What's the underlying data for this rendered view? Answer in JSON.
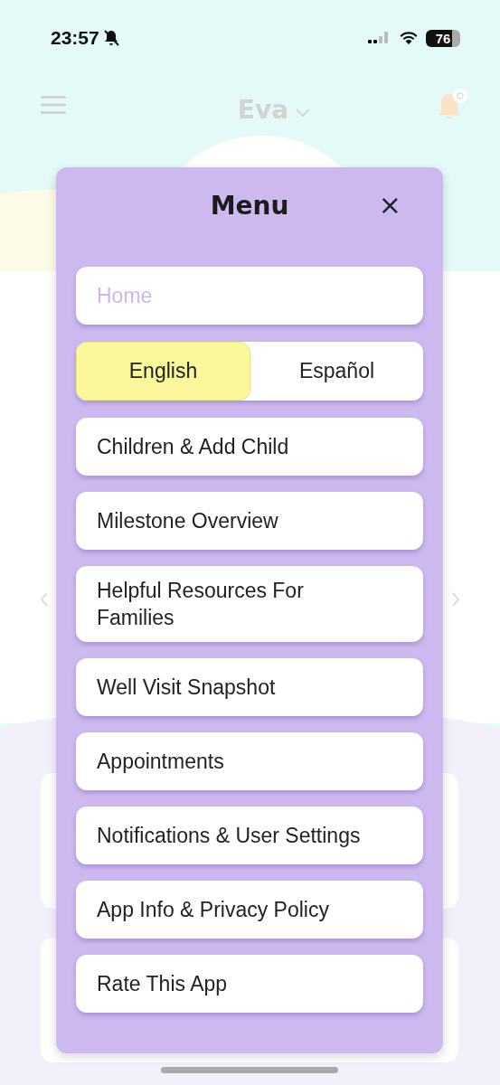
{
  "status_bar": {
    "time": "23:57",
    "battery": "76"
  },
  "header": {
    "child_name": "Eva"
  },
  "menu": {
    "title": "Menu",
    "close": "×",
    "items": [
      {
        "kind": "link",
        "label": "Home",
        "selected": true
      },
      {
        "kind": "language",
        "options": [
          {
            "label": "English",
            "selected": true
          },
          {
            "label": "Español",
            "selected": false
          }
        ]
      },
      {
        "kind": "link",
        "label": "Children & Add Child",
        "selected": false
      },
      {
        "kind": "link",
        "label": "Milestone Overview",
        "selected": false
      },
      {
        "kind": "link",
        "label": "Helpful Resources For Families",
        "selected": false
      },
      {
        "kind": "link",
        "label": "Well Visit Snapshot",
        "selected": false
      },
      {
        "kind": "link",
        "label": "Appointments",
        "selected": false
      },
      {
        "kind": "link",
        "label": "Notifications & User Settings",
        "selected": false
      },
      {
        "kind": "link",
        "label": "App Info & Privacy Policy",
        "selected": false
      },
      {
        "kind": "link",
        "label": "Rate This App",
        "selected": false
      }
    ]
  }
}
